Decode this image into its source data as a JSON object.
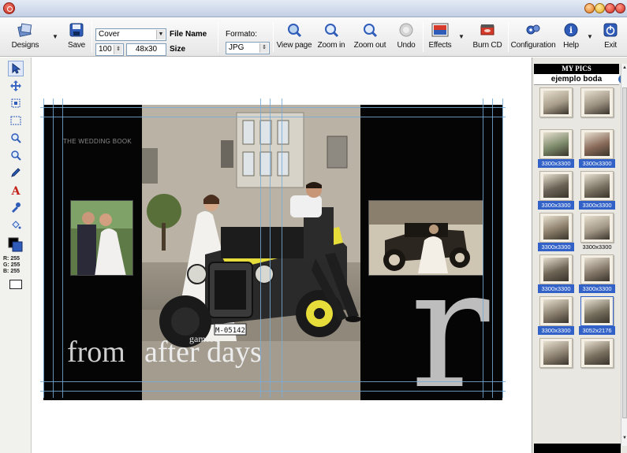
{
  "toolbar": {
    "designs_label": "Designs",
    "save_label": "Save",
    "name_value": "Cover",
    "file_name_label": "File Name",
    "zoom_value": "100",
    "size_value": "48x30",
    "size_label": "Size",
    "format_label": "Formato:",
    "format_value": "JPG",
    "view_page_label": "View page",
    "zoom_in_label": "Zoom in",
    "zoom_out_label": "Zoom out",
    "undo_label": "Undo",
    "effects_label": "Effects",
    "burn_cd_label": "Burn CD",
    "configuration_label": "Configuration",
    "help_label": "Help",
    "exit_label": "Exit"
  },
  "tools": {
    "color_readout": {
      "r": "R: 255",
      "g": "G: 255",
      "b": "B: 255"
    }
  },
  "canvas": {
    "book_title": "THE WEDDING BOOK",
    "caption_from": "from",
    "caption_after": "after days",
    "caption_games": "games",
    "big_letter": "r",
    "license_plate": "M-05142"
  },
  "mypics": {
    "header": "MY PICS",
    "album_name": "ejemplo boda",
    "thumbnails": [
      {
        "label": "",
        "tone": "#a89d8a"
      },
      {
        "label": "",
        "tone": "#9c9282"
      },
      {
        "label": "3300x3300",
        "tone": "#7c8a6a"
      },
      {
        "label": "3300x3300",
        "tone": "#8a6b5a"
      },
      {
        "label": "3300x3300",
        "tone": "#6b6355"
      },
      {
        "label": "3300x3300",
        "tone": "#7d7565"
      },
      {
        "label": "3300x3300",
        "tone": "#8b7e6a"
      },
      {
        "label": "3300x3300",
        "tone": "#a39887"
      },
      {
        "label": "3300x3300",
        "tone": "#6e6556"
      },
      {
        "label": "3300x3300",
        "tone": "#85796a"
      },
      {
        "label": "3300x3300",
        "tone": "#8a7f6f"
      },
      {
        "label": "3052x2176",
        "tone": "#77705f"
      },
      {
        "label": "",
        "tone": "#8f8473"
      },
      {
        "label": "",
        "tone": "#7a7060"
      }
    ]
  }
}
